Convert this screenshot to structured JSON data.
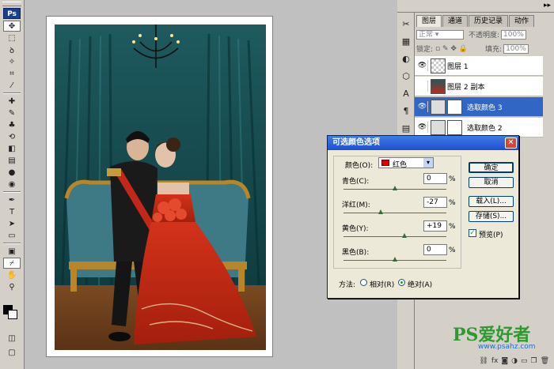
{
  "app": {
    "logo": "Ps"
  },
  "tools": [
    "move",
    "marquee",
    "lasso",
    "magic-wand",
    "crop",
    "slice",
    "healing",
    "brush",
    "stamp",
    "history-brush",
    "eraser",
    "gradient",
    "blur",
    "dodge",
    "pen",
    "type",
    "path-select",
    "shape",
    "notes",
    "eyedropper",
    "hand",
    "zoom"
  ],
  "layers_panel": {
    "tabs": [
      "图层",
      "通道",
      "历史记录",
      "动作"
    ],
    "blend_mode": "正常",
    "opacity_label": "不透明度:",
    "opacity_value": "100%",
    "lock_label": "锁定:",
    "fill_label": "填充:",
    "fill_value": "100%",
    "layers": [
      {
        "name": "图层 1",
        "selected": false
      },
      {
        "name": "图层 2 副本",
        "selected": false
      },
      {
        "name": "选取颜色 3",
        "selected": true
      },
      {
        "name": "选取颜色 2",
        "selected": false
      }
    ],
    "footer_icons": [
      "link-icon",
      "fx-icon",
      "mask-icon",
      "adjustment-icon",
      "folder-icon",
      "new-layer-icon",
      "trash-icon"
    ]
  },
  "dialog": {
    "title": "可选颜色选项",
    "colors_label": "颜色(O):",
    "colors_value": "红色",
    "swatch_color": "#e00000",
    "sliders": [
      {
        "label": "青色(C):",
        "value": "0",
        "level": 0
      },
      {
        "label": "洋红(M):",
        "value": "-27",
        "level": -27
      },
      {
        "label": "黄色(Y):",
        "value": "+19",
        "level": 19
      },
      {
        "label": "黑色(B):",
        "value": "0",
        "level": 0
      }
    ],
    "percent": "%",
    "buttons": {
      "ok": "确定",
      "cancel": "取消",
      "load": "载入(L)...",
      "save": "存储(S)..."
    },
    "preview_label": "预览(P)",
    "preview_checked": true,
    "method_label": "方法:",
    "method_relative": "相对(R)",
    "method_absolute": "绝对(A)",
    "method_selected": "absolute"
  },
  "watermark": {
    "logo": "PS爱好者",
    "url": "www.psahz.com"
  }
}
